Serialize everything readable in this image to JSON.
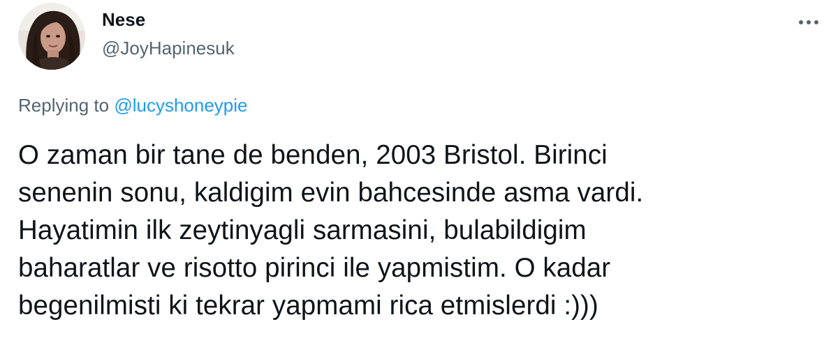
{
  "tweet": {
    "author": {
      "display_name": "Nese",
      "handle": "@JoyHapinesuk",
      "avatar_icon": "avatar-photo"
    },
    "more_icon": "more-horizontal-icon",
    "reply_context": {
      "prefix": "Replying to",
      "mention": "@lucyshoneypie"
    },
    "text_lines": [
      "O zaman bir tane de benden, 2003 Bristol. Birinci",
      "senenin sonu, kaldigim evin bahcesinde asma vardi.",
      "Hayatimin ilk zeytinyagli sarmasini, bulabildigim",
      "baharatlar ve risotto pirinci ile yapmistim. O kadar",
      "begenilmisti ki tekrar yapmami rica etmislerdi :)))"
    ]
  },
  "colors": {
    "text_primary": "#0f1419",
    "text_secondary": "#536471",
    "link": "#1d9bf0"
  }
}
